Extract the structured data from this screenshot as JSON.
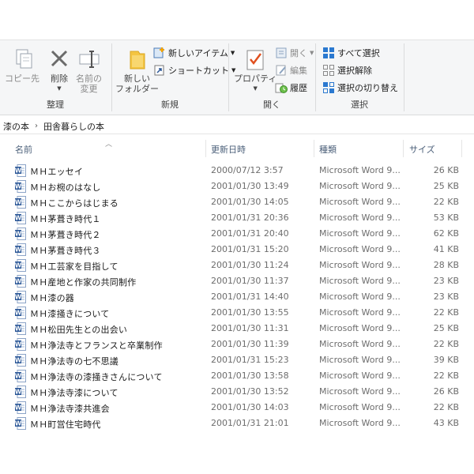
{
  "ribbon": {
    "groups": {
      "organize": {
        "label": "整理",
        "copy_to": "コピー先",
        "delete": "削除",
        "rename_line1": "名前の",
        "rename_line2": "変更"
      },
      "new": {
        "label": "新規",
        "new_folder_line1": "新しい",
        "new_folder_line2": "フォルダー",
        "new_item": "新しいアイテム",
        "shortcut": "ショートカット"
      },
      "open": {
        "label": "開く",
        "properties": "プロパティ",
        "open": "開く",
        "edit": "編集",
        "history": "履歴"
      },
      "select": {
        "label": "選択",
        "select_all": "すべて選択",
        "select_none": "選択解除",
        "invert": "選択の切り替え"
      }
    }
  },
  "address": {
    "crumbs": [
      "漆の本",
      "田舎暮らしの本"
    ]
  },
  "columns": {
    "name": "名前",
    "modified": "更新日時",
    "type": "種類",
    "size": "サイズ"
  },
  "files": [
    {
      "name": "ＭＨエッセイ",
      "modified": "2000/07/12 3:57",
      "type": "Microsoft Word 9...",
      "size": "26 KB"
    },
    {
      "name": "ＭＨお椀のはなし",
      "modified": "2001/01/30 13:49",
      "type": "Microsoft Word 9...",
      "size": "25 KB"
    },
    {
      "name": "ＭＨここからはじまる",
      "modified": "2001/01/30 14:05",
      "type": "Microsoft Word 9...",
      "size": "22 KB"
    },
    {
      "name": "ＭＨ茅葺き時代１",
      "modified": "2001/01/31 20:36",
      "type": "Microsoft Word 9...",
      "size": "53 KB"
    },
    {
      "name": "ＭＨ茅葺き時代２",
      "modified": "2001/01/31 20:40",
      "type": "Microsoft Word 9...",
      "size": "62 KB"
    },
    {
      "name": "ＭＨ茅葺き時代３",
      "modified": "2001/01/31 15:20",
      "type": "Microsoft Word 9...",
      "size": "41 KB"
    },
    {
      "name": "ＭＨ工芸家を目指して",
      "modified": "2001/01/30 11:24",
      "type": "Microsoft Word 9...",
      "size": "28 KB"
    },
    {
      "name": "ＭＨ産地と作家の共同制作",
      "modified": "2001/01/30 11:37",
      "type": "Microsoft Word 9...",
      "size": "23 KB"
    },
    {
      "name": "ＭＨ漆の器",
      "modified": "2001/01/31 14:40",
      "type": "Microsoft Word 9...",
      "size": "23 KB"
    },
    {
      "name": "ＭＨ漆掻きについて",
      "modified": "2001/01/30 13:55",
      "type": "Microsoft Word 9...",
      "size": "22 KB"
    },
    {
      "name": "ＭＨ松田先生との出会い",
      "modified": "2001/01/30 11:31",
      "type": "Microsoft Word 9...",
      "size": "25 KB"
    },
    {
      "name": "ＭＨ浄法寺とフランスと卒業制作",
      "modified": "2001/01/30 11:39",
      "type": "Microsoft Word 9...",
      "size": "22 KB"
    },
    {
      "name": "ＭＨ浄法寺の七不思議",
      "modified": "2001/01/31 15:23",
      "type": "Microsoft Word 9...",
      "size": "39 KB"
    },
    {
      "name": "ＭＨ浄法寺の漆掻きさんについて",
      "modified": "2001/01/30 13:58",
      "type": "Microsoft Word 9...",
      "size": "22 KB"
    },
    {
      "name": "ＭＨ浄法寺漆について",
      "modified": "2001/01/30 13:52",
      "type": "Microsoft Word 9...",
      "size": "26 KB"
    },
    {
      "name": "ＭＨ浄法寺漆共進会",
      "modified": "2001/01/30 14:03",
      "type": "Microsoft Word 9...",
      "size": "22 KB"
    },
    {
      "name": "ＭＨ町営住宅時代",
      "modified": "2001/01/31 21:01",
      "type": "Microsoft Word 9...",
      "size": "43 KB"
    }
  ],
  "colors": {
    "ribbon_bg": "#f5f6f7",
    "header_text": "#4c607a",
    "word_blue": "#2b5797",
    "folder_yellow": "#f4c542"
  },
  "icons": [
    "copy-to-icon",
    "delete-icon",
    "rename-icon",
    "new-folder-icon",
    "new-item-icon",
    "shortcut-icon",
    "properties-icon",
    "open-icon",
    "edit-icon",
    "history-icon",
    "select-all-icon",
    "select-none-icon",
    "invert-selection-icon",
    "word-document-icon"
  ]
}
